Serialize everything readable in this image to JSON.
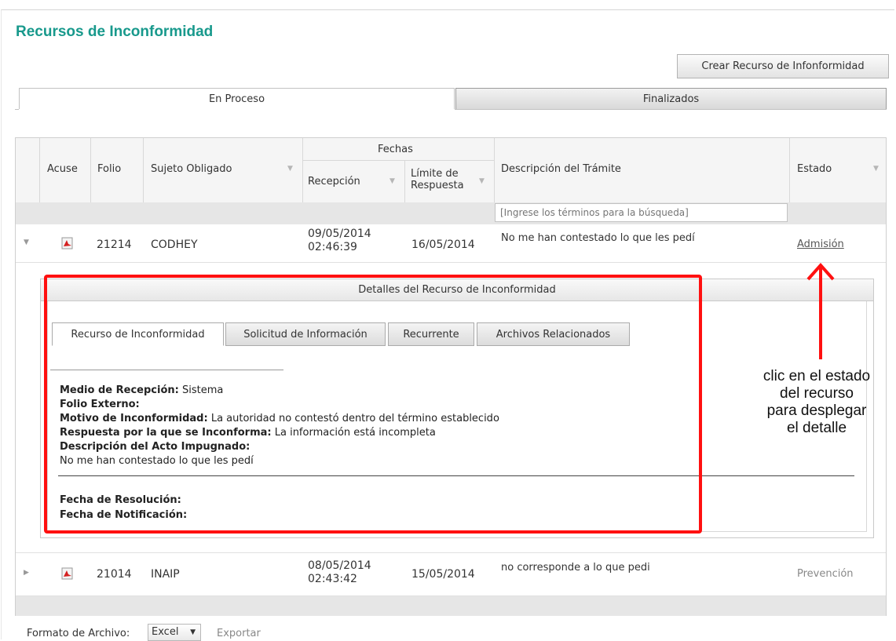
{
  "page": {
    "title": "Recursos de Inconformidad",
    "create_button": "Crear Recurso de Infonformidad"
  },
  "tabs": [
    {
      "label": "En Proceso"
    },
    {
      "label": "Finalizados"
    }
  ],
  "table": {
    "headers": {
      "acuse": "Acuse",
      "folio": "Folio",
      "sujeto": "Sujeto Obligado",
      "fechas": "Fechas",
      "recepcion": "Recepción",
      "limite_l1": "Límite de",
      "limite_l2": "Respuesta",
      "descripcion": "Descripción del Trámite",
      "estado": "Estado"
    },
    "search_placeholder": "[Ingrese los términos para la búsqueda]",
    "rows": [
      {
        "folio": "21214",
        "sujeto": "CODHEY",
        "recepcion_date": "09/05/2014",
        "recepcion_time": "02:46:39",
        "limite": "16/05/2014",
        "descripcion": "No me han contestado lo que les pedí",
        "estado": "Admisión"
      },
      {
        "folio": "21014",
        "sujeto": "INAIP",
        "recepcion_date": "08/05/2014",
        "recepcion_time": "02:43:42",
        "limite": "15/05/2014",
        "descripcion": "no corresponde a lo que pedi",
        "estado": "Prevención"
      }
    ]
  },
  "detail": {
    "title": "Detalles del Recurso de Inconformidad",
    "tabs": [
      "Recurso de Inconformidad",
      "Solicitud de Información",
      "Recurrente",
      "Archivos Relacionados"
    ],
    "fields": {
      "medio_label": "Medio de Recepción:",
      "medio_value": " Sistema",
      "folio_ext_label": "Folio Externo:",
      "motivo_label": "Motivo de Inconformidad:",
      "motivo_value": " La autoridad no contestó dentro del término establecido",
      "respuesta_label": "Respuesta por la que se Inconforma:",
      "respuesta_value": " La información está incompleta",
      "acto_label": "Descripción del Acto Impugnado:",
      "acto_value": "No me han contestado lo que les pedí",
      "resolucion_label": "Fecha de Resolución:",
      "notificacion_label": "Fecha de Notificación:"
    }
  },
  "annotation": {
    "line1": "clic en el estado",
    "line2": "del recurso",
    "line3": "para desplegar",
    "line4": "el detalle"
  },
  "footer": {
    "format_label": "Formato de Archivo:",
    "format_value": "Excel",
    "export_label": "Exportar"
  },
  "colors": {
    "title": "#18998c",
    "annotation": "#ff1010"
  },
  "icons": {
    "acuse": "pdf-icon",
    "expand": "triangle-right-icon",
    "collapse": "triangle-down-icon",
    "filter": "funnel-icon"
  }
}
